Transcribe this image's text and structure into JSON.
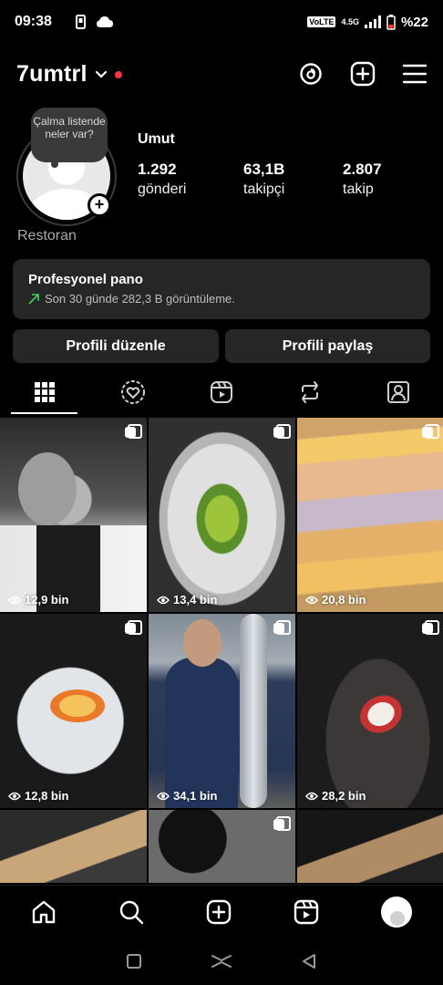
{
  "status_bar": {
    "time": "09:38",
    "volte": "VoLTE",
    "network": "4.5G",
    "battery": "%22"
  },
  "header": {
    "username": "7umtrl"
  },
  "profile": {
    "note": "Çalma listende neler var?",
    "display_name": "Umut",
    "category": "Restoran",
    "stats": [
      {
        "value": "1.292",
        "label": "gönderi"
      },
      {
        "value": "63,1B",
        "label": "takipçi"
      },
      {
        "value": "2.807",
        "label": "takip"
      }
    ]
  },
  "dashboard": {
    "title": "Profesyonel pano",
    "subtitle": "Son 30 günde 282,3 B görüntüleme."
  },
  "buttons": {
    "edit": "Profili düzenle",
    "share": "Profili paylaş"
  },
  "tabs": [
    "grid-icon",
    "heart-circle-icon",
    "reels-icon",
    "repost-icon",
    "tagged-icon"
  ],
  "posts": [
    {
      "views": "12,9 bin"
    },
    {
      "views": "13,4 bin"
    },
    {
      "views": "20,8 bin"
    },
    {
      "views": "12,8 bin"
    },
    {
      "views": "34,1 bin"
    },
    {
      "views": "28,2 bin"
    }
  ],
  "colors": {
    "accent_red": "#ff3040",
    "trend_green": "#3ecf5e",
    "card_bg": "#262626"
  }
}
